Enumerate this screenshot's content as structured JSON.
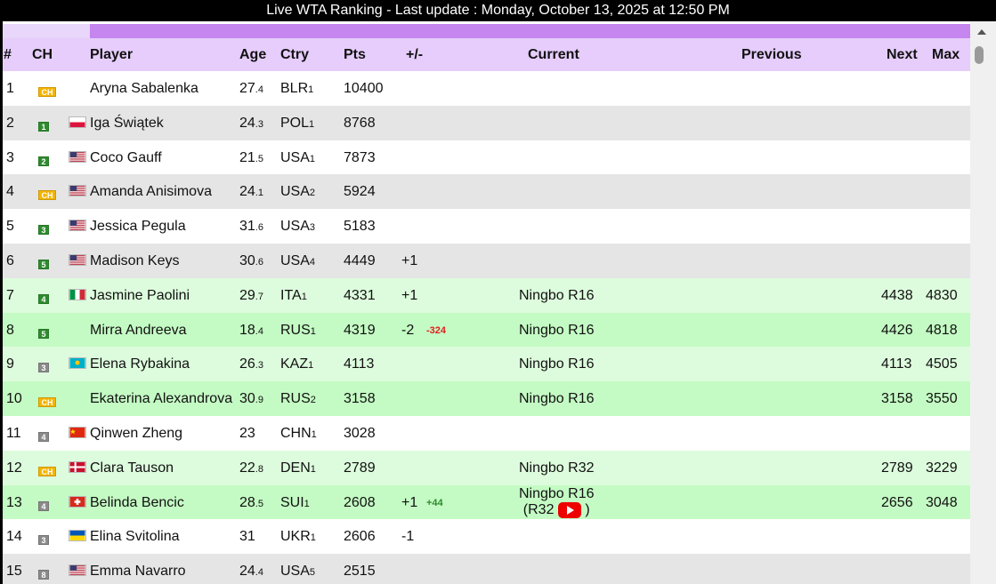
{
  "header": {
    "title": "Live WTA Ranking - Last update : Monday, October 13, 2025 at 12:50 PM"
  },
  "columns": {
    "rank": "#",
    "ch": "CH",
    "player": "Player",
    "age": "Age",
    "ctry": "Ctry",
    "pts": "Pts",
    "diff": "+/-",
    "current": "Current",
    "previous": "Previous",
    "next": "Next",
    "max": "Max"
  },
  "colors": {
    "row_white": "#ffffff",
    "row_grey": "#e5e5e5",
    "row_lightgreen": "#ddfcdd",
    "row_green": "#c4fbc4",
    "header": "#e6cdfb",
    "header_strip": "#c586f0",
    "badge_ch": "#f4b400",
    "badge_green": "#2e8b2e",
    "badge_grey": "#8a8a8a",
    "delta_negative": "#e02020",
    "delta_positive": "#2e8b2e"
  },
  "rows": [
    {
      "rank": "1",
      "ch_badge": "CH",
      "ch_style": "ch",
      "flag": "",
      "player": "Aryna Sabalenka",
      "age": "27",
      "age_dec": ".4",
      "ctry": "BLR",
      "ctry_rank": "1",
      "pts": "10400",
      "diff": "",
      "delta": "",
      "delta_sign": "",
      "current": "",
      "current_extra": "",
      "next": "",
      "max": "",
      "bg": "white"
    },
    {
      "rank": "2",
      "ch_badge": "1",
      "ch_style": "green",
      "flag": "pol",
      "player": "Iga Świątek",
      "age": "24",
      "age_dec": ".3",
      "ctry": "POL",
      "ctry_rank": "1",
      "pts": "8768",
      "diff": "",
      "delta": "",
      "delta_sign": "",
      "current": "",
      "current_extra": "",
      "next": "",
      "max": "",
      "bg": "grey"
    },
    {
      "rank": "3",
      "ch_badge": "2",
      "ch_style": "green",
      "flag": "usa",
      "player": "Coco Gauff",
      "age": "21",
      "age_dec": ".5",
      "ctry": "USA",
      "ctry_rank": "1",
      "pts": "7873",
      "diff": "",
      "delta": "",
      "delta_sign": "",
      "current": "",
      "current_extra": "",
      "next": "",
      "max": "",
      "bg": "white"
    },
    {
      "rank": "4",
      "ch_badge": "CH",
      "ch_style": "ch",
      "flag": "usa",
      "player": "Amanda Anisimova",
      "age": "24",
      "age_dec": ".1",
      "ctry": "USA",
      "ctry_rank": "2",
      "pts": "5924",
      "diff": "",
      "delta": "",
      "delta_sign": "",
      "current": "",
      "current_extra": "",
      "next": "",
      "max": "",
      "bg": "grey"
    },
    {
      "rank": "5",
      "ch_badge": "3",
      "ch_style": "green",
      "flag": "usa",
      "player": "Jessica Pegula",
      "age": "31",
      "age_dec": ".6",
      "ctry": "USA",
      "ctry_rank": "3",
      "pts": "5183",
      "diff": "",
      "delta": "",
      "delta_sign": "",
      "current": "",
      "current_extra": "",
      "next": "",
      "max": "",
      "bg": "white"
    },
    {
      "rank": "6",
      "ch_badge": "5",
      "ch_style": "green",
      "flag": "usa",
      "player": "Madison Keys",
      "age": "30",
      "age_dec": ".6",
      "ctry": "USA",
      "ctry_rank": "4",
      "pts": "4449",
      "diff": "+1",
      "delta": "",
      "delta_sign": "",
      "current": "",
      "current_extra": "",
      "next": "",
      "max": "",
      "bg": "grey"
    },
    {
      "rank": "7",
      "ch_badge": "4",
      "ch_style": "green",
      "flag": "ita",
      "player": "Jasmine Paolini",
      "age": "29",
      "age_dec": ".7",
      "ctry": "ITA",
      "ctry_rank": "1",
      "pts": "4331",
      "diff": "+1",
      "delta": "",
      "delta_sign": "",
      "current": "Ningbo R16",
      "current_extra": "",
      "next": "4438",
      "max": "4830",
      "bg": "lightgreen"
    },
    {
      "rank": "8",
      "ch_badge": "5",
      "ch_style": "green",
      "flag": "",
      "player": "Mirra Andreeva",
      "age": "18",
      "age_dec": ".4",
      "ctry": "RUS",
      "ctry_rank": "1",
      "pts": "4319",
      "diff": "-2",
      "delta": "-324",
      "delta_sign": "neg",
      "current": "Ningbo R16",
      "current_extra": "",
      "next": "4426",
      "max": "4818",
      "bg": "green"
    },
    {
      "rank": "9",
      "ch_badge": "3",
      "ch_style": "grey",
      "flag": "kaz",
      "player": "Elena Rybakina",
      "age": "26",
      "age_dec": ".3",
      "ctry": "KAZ",
      "ctry_rank": "1",
      "pts": "4113",
      "diff": "",
      "delta": "",
      "delta_sign": "",
      "current": "Ningbo R16",
      "current_extra": "",
      "next": "4113",
      "max": "4505",
      "bg": "lightgreen"
    },
    {
      "rank": "10",
      "ch_badge": "CH",
      "ch_style": "ch",
      "flag": "",
      "player": "Ekaterina Alexandrova",
      "age": "30",
      "age_dec": ".9",
      "ctry": "RUS",
      "ctry_rank": "2",
      "pts": "3158",
      "diff": "",
      "delta": "",
      "delta_sign": "",
      "current": "Ningbo R16",
      "current_extra": "",
      "next": "3158",
      "max": "3550",
      "bg": "green"
    },
    {
      "rank": "11",
      "ch_badge": "4",
      "ch_style": "grey",
      "flag": "chn",
      "player": "Qinwen Zheng",
      "age": "23",
      "age_dec": "",
      "ctry": "CHN",
      "ctry_rank": "1",
      "pts": "3028",
      "diff": "",
      "delta": "",
      "delta_sign": "",
      "current": "",
      "current_extra": "",
      "next": "",
      "max": "",
      "bg": "white"
    },
    {
      "rank": "12",
      "ch_badge": "CH",
      "ch_style": "ch",
      "flag": "den",
      "player": "Clara Tauson",
      "age": "22",
      "age_dec": ".8",
      "ctry": "DEN",
      "ctry_rank": "1",
      "pts": "2789",
      "diff": "",
      "delta": "",
      "delta_sign": "",
      "current": "Ningbo R32",
      "current_extra": "",
      "next": "2789",
      "max": "3229",
      "bg": "lightgreen"
    },
    {
      "rank": "13",
      "ch_badge": "4",
      "ch_style": "grey",
      "flag": "sui",
      "player": "Belinda Bencic",
      "age": "28",
      "age_dec": ".5",
      "ctry": "SUI",
      "ctry_rank": "1",
      "pts": "2608",
      "diff": "+1",
      "delta": "+44",
      "delta_sign": "pos",
      "current": "Ningbo R16",
      "current_extra": "(R32",
      "next": "2656",
      "max": "3048",
      "bg": "green"
    },
    {
      "rank": "14",
      "ch_badge": "3",
      "ch_style": "grey",
      "flag": "ukr",
      "player": "Elina Svitolina",
      "age": "31",
      "age_dec": "",
      "ctry": "UKR",
      "ctry_rank": "1",
      "pts": "2606",
      "diff": "-1",
      "delta": "",
      "delta_sign": "",
      "current": "",
      "current_extra": "",
      "next": "",
      "max": "",
      "bg": "white"
    },
    {
      "rank": "15",
      "ch_badge": "8",
      "ch_style": "grey",
      "flag": "usa",
      "player": "Emma Navarro",
      "age": "24",
      "age_dec": ".4",
      "ctry": "USA",
      "ctry_rank": "5",
      "pts": "2515",
      "diff": "",
      "delta": "",
      "delta_sign": "",
      "current": "",
      "current_extra": "",
      "next": "",
      "max": "",
      "bg": "grey"
    }
  ]
}
